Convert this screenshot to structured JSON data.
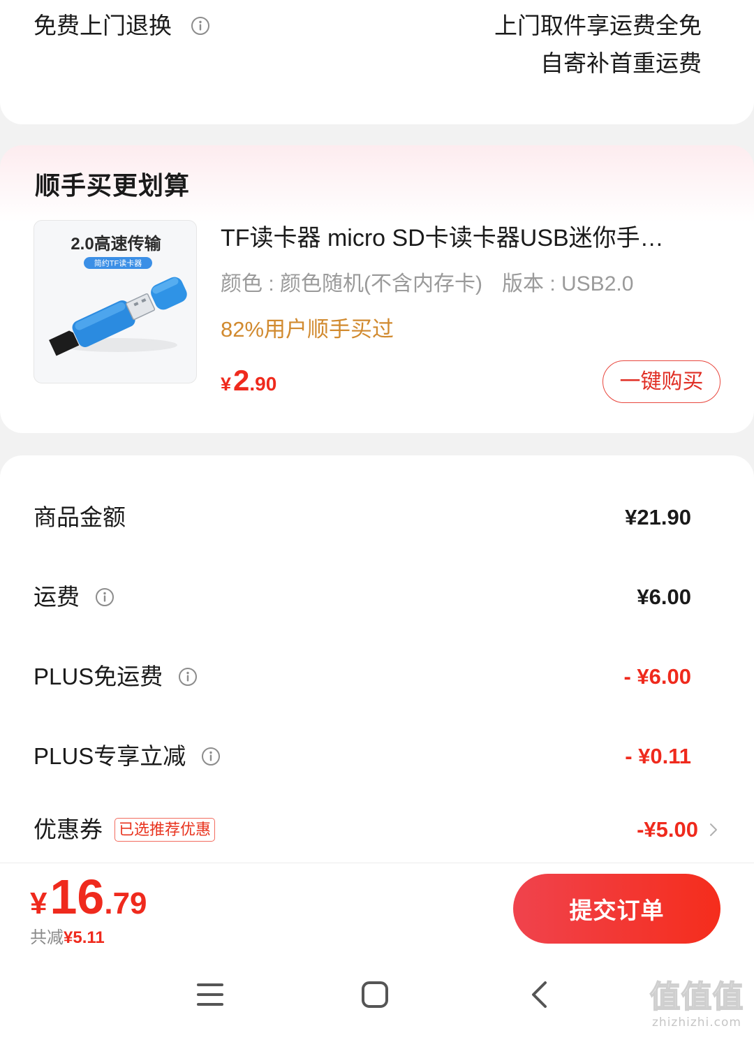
{
  "colors": {
    "page_bg": "#f2f2f2",
    "card_bg": "#ffffff",
    "text_primary": "#1a1a1a",
    "text_secondary": "#9a9a9a",
    "accent_red": "#ef2a1d",
    "social_proof_orange": "#d18a2f",
    "addon_header_tint": "#fdecef",
    "product_image_blue": "#2f8fe0"
  },
  "return_service": {
    "label": "免费上门退换",
    "icon": "info-icon",
    "detail_lines": [
      "上门取件享运费全免",
      "自寄补首重运费"
    ]
  },
  "addon_section": {
    "title": "顺手买更划算",
    "product": {
      "image": {
        "headline": "2.0高速传输",
        "badge": "简约TF读卡器",
        "icon": "usb-card-reader-image"
      },
      "title": "TF读卡器 micro SD卡读卡器USB迷你手…",
      "specs": [
        "颜色 : 颜色随机(不含内存卡)",
        "版本 : USB2.0"
      ],
      "social_proof": "82%用户顺手买过",
      "price": {
        "currency": "¥",
        "integer": "2",
        "decimal": ".90"
      },
      "buy_button": "一键购买"
    }
  },
  "price_summary": {
    "rows": [
      {
        "label": "商品金额",
        "value": "¥21.90",
        "highlight": false
      },
      {
        "label": "运费",
        "icon": "info-icon",
        "value": "¥6.00",
        "highlight": false
      },
      {
        "label": "PLUS免运费",
        "icon": "info-icon",
        "value": "- ¥6.00",
        "highlight": true
      },
      {
        "label": "PLUS专享立减",
        "icon": "info-icon",
        "value": "- ¥0.11",
        "highlight": true
      },
      {
        "label": "优惠券",
        "badge": "已选推荐优惠",
        "value": "-¥5.00",
        "highlight": true,
        "icon": "chevron-right-icon"
      }
    ]
  },
  "checkout_bar": {
    "total": {
      "currency": "¥",
      "integer": "16",
      "decimal": ".79"
    },
    "saved_label": "共减",
    "saved_amount": "¥5.11",
    "submit_button": "提交订单"
  },
  "system_nav": {
    "icons": [
      "menu-icon",
      "home-icon",
      "back-icon"
    ]
  },
  "watermark": {
    "logo": "值值值",
    "url": "zhizhizhi.com"
  }
}
